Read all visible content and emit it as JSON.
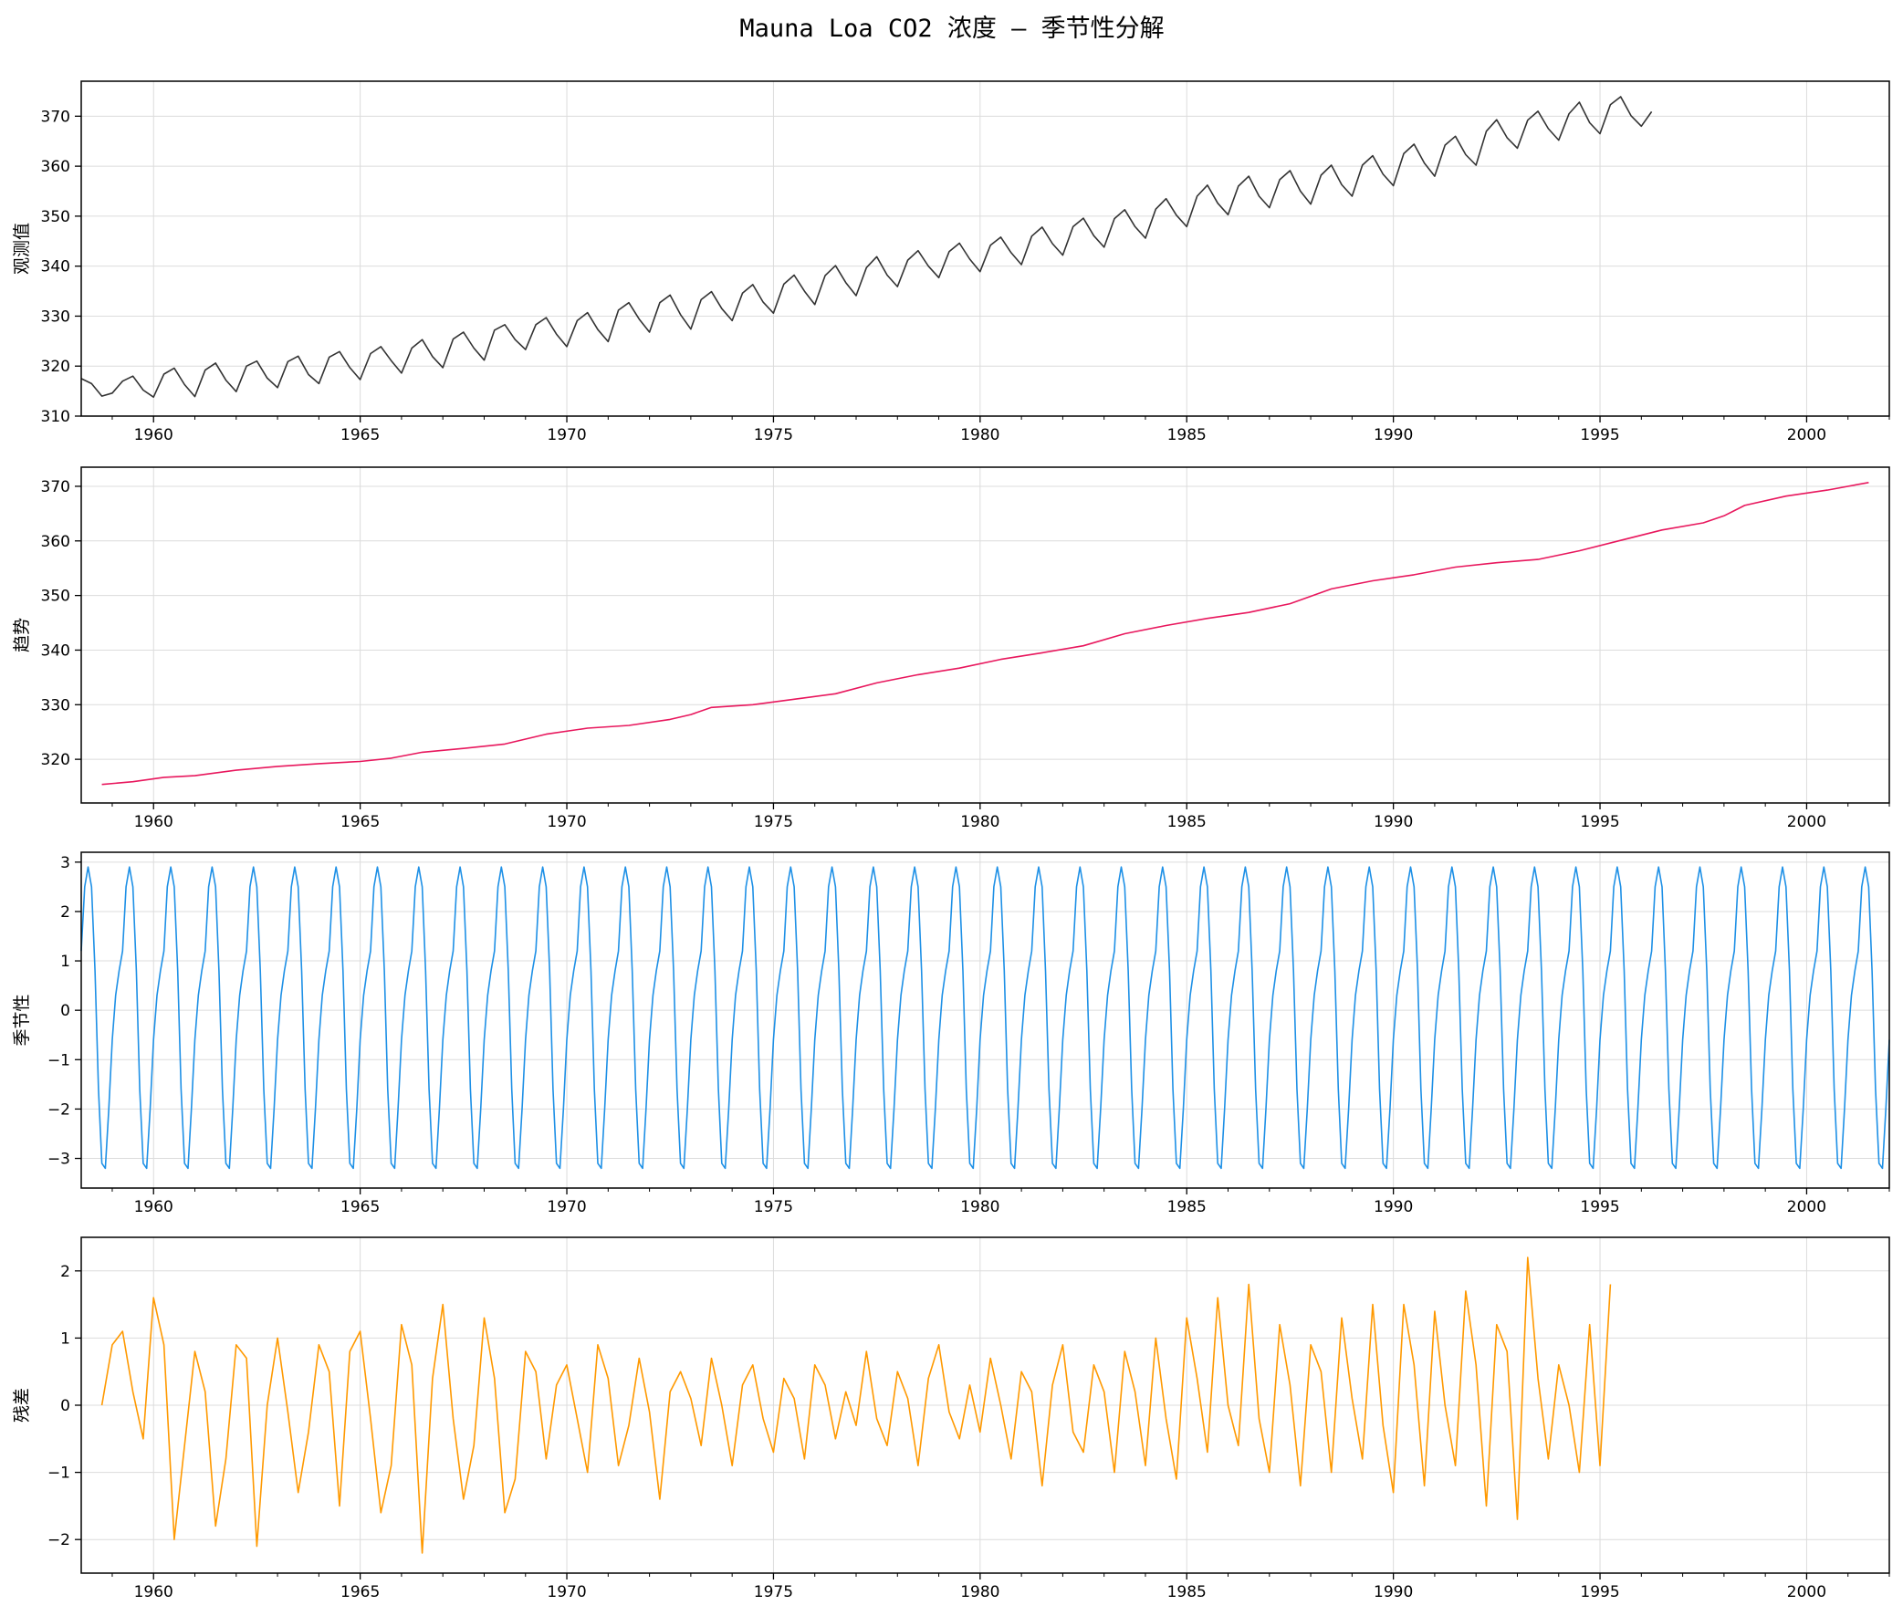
{
  "title": "Mauna Loa CO2 浓度 — 季节性分解",
  "chart_data": [
    {
      "type": "line",
      "ylabel": "观测值",
      "color": "#333333",
      "xlim": [
        1958.25,
        2002.0
      ],
      "ylim": [
        310,
        377
      ],
      "xticks": [
        1960,
        1965,
        1970,
        1975,
        1980,
        1985,
        1990,
        1995,
        2000
      ],
      "xtick_labels": [
        "1960",
        "1965",
        "1970",
        "1975",
        "1980",
        "1985",
        "1990",
        "1995",
        "2000"
      ],
      "yticks": [
        310,
        320,
        330,
        340,
        350,
        360,
        370
      ],
      "ytick_labels": [
        "310",
        "320",
        "330",
        "340",
        "350",
        "360",
        "370"
      ],
      "grid": true,
      "series": [
        {
          "x_start": 1958.25,
          "x_step": 0.25,
          "values": [
            317.5,
            316.5,
            314.0,
            314.6,
            317.0,
            318.0,
            315.2,
            313.8,
            318.4,
            319.6,
            316.3,
            313.9,
            319.2,
            320.6,
            317.2,
            314.9,
            320.0,
            321.0,
            317.6,
            315.7,
            320.9,
            322.0,
            318.3,
            316.5,
            321.8,
            322.9,
            319.7,
            317.3,
            322.5,
            323.9,
            321.1,
            318.6,
            323.6,
            325.3,
            321.9,
            319.7,
            325.4,
            326.8,
            323.6,
            321.2,
            327.2,
            328.3,
            325.3,
            323.3,
            328.3,
            329.7,
            326.4,
            323.9,
            329.1,
            330.7,
            327.3,
            324.9,
            331.2,
            332.7,
            329.4,
            326.8,
            332.7,
            334.2,
            330.3,
            327.4,
            333.3,
            334.9,
            331.5,
            329.1,
            334.6,
            336.3,
            332.8,
            330.6,
            336.4,
            338.2,
            335.0,
            332.3,
            338.1,
            340.1,
            336.7,
            334.1,
            339.7,
            341.9,
            338.2,
            335.9,
            341.2,
            343.1,
            340.0,
            337.7,
            342.9,
            344.6,
            341.4,
            338.9,
            344.2,
            345.8,
            342.7,
            340.3,
            346.0,
            347.8,
            344.5,
            342.2,
            347.9,
            349.6,
            346.1,
            343.8,
            349.5,
            351.3,
            347.9,
            345.6,
            351.4,
            353.5,
            350.2,
            347.9,
            354.0,
            356.2,
            352.6,
            350.3,
            356.0,
            358.0,
            354.0,
            351.7,
            357.3,
            359.1,
            355.0,
            352.4,
            358.2,
            360.2,
            356.3,
            354.0,
            360.2,
            362.1,
            358.4,
            356.1,
            362.5,
            364.4,
            360.6,
            358.0,
            364.2,
            366.0,
            362.3,
            360.2,
            367.0,
            369.3,
            365.7,
            363.6,
            369.2,
            371.0,
            367.5,
            365.2,
            370.5,
            372.8,
            368.7,
            366.5,
            372.3,
            373.9,
            370.1,
            368.0,
            370.9
          ]
        }
      ]
    },
    {
      "type": "line",
      "ylabel": "趋势",
      "color": "#e8175d",
      "xlim": [
        1958.25,
        2002.0
      ],
      "ylim": [
        312,
        373.5
      ],
      "xticks": [
        1960,
        1965,
        1970,
        1975,
        1980,
        1985,
        1990,
        1995,
        2000
      ],
      "xtick_labels": [
        "1960",
        "1965",
        "1970",
        "1975",
        "1980",
        "1985",
        "1990",
        "1995",
        "2000"
      ],
      "yticks": [
        320,
        330,
        340,
        350,
        360,
        370
      ],
      "ytick_labels": [
        "320",
        "330",
        "340",
        "350",
        "360",
        "370"
      ],
      "grid": true,
      "series": [
        {
          "x": [
            1958.75,
            1959.5,
            1960.25,
            1961.0,
            1962.0,
            1963.0,
            1964.0,
            1965.0,
            1965.75,
            1966.5,
            1967.5,
            1968.5,
            1969.5,
            1970.5,
            1971.5,
            1972.5,
            1973.0,
            1973.5,
            1974.5,
            1975.5,
            1976.5,
            1977.5,
            1978.5,
            1979.5,
            1980.5,
            1981.5,
            1982.5,
            1983.5,
            1984.5,
            1985.5,
            1986.5,
            1987.5,
            1988.5,
            1989.5,
            1990.5,
            1991.5,
            1992.5,
            1993.5,
            1994.5,
            1995.5,
            1996.5,
            1997.5,
            1998.0,
            1998.5,
            1999.5,
            2000.5,
            2001.5
          ],
          "values": [
            315.4,
            315.9,
            316.7,
            317.0,
            318.0,
            318.7,
            319.2,
            319.6,
            320.2,
            321.3,
            322.0,
            322.8,
            324.6,
            325.7,
            326.2,
            327.3,
            328.2,
            329.5,
            330.0,
            331.0,
            332.0,
            334.0,
            335.5,
            336.7,
            338.3,
            339.5,
            340.8,
            343.0,
            344.5,
            345.8,
            346.9,
            348.5,
            351.2,
            352.7,
            353.8,
            355.2,
            356.0,
            356.6,
            358.2,
            360.1,
            362.0,
            363.3,
            364.6,
            366.5,
            368.2,
            369.3,
            370.7
          ]
        }
      ]
    },
    {
      "type": "line",
      "ylabel": "季节性",
      "color": "#1e90e6",
      "xlim": [
        1958.25,
        2002.0
      ],
      "ylim": [
        -3.6,
        3.2
      ],
      "xticks": [
        1960,
        1965,
        1970,
        1975,
        1980,
        1985,
        1990,
        1995,
        2000
      ],
      "xtick_labels": [
        "1960",
        "1965",
        "1970",
        "1975",
        "1980",
        "1985",
        "1990",
        "1995",
        "2000"
      ],
      "yticks": [
        -3,
        -2,
        -1,
        0,
        1,
        2,
        3
      ],
      "ytick_labels": [
        "−3",
        "−2",
        "−1",
        "0",
        "1",
        "2",
        "3"
      ],
      "grid": true,
      "series": [
        {
          "x_start": 1958.25,
          "x_step": 0.0833333,
          "cycle_values": [
            1.2,
            2.5,
            2.9,
            2.5,
            0.8,
            -1.6,
            -3.1,
            -3.2,
            -2.0,
            -0.6,
            0.3,
            0.8
          ]
        }
      ]
    },
    {
      "type": "line",
      "ylabel": "残差",
      "color": "#ff9900",
      "xlim": [
        1958.25,
        2002.0
      ],
      "ylim": [
        -2.5,
        2.5
      ],
      "xticks": [
        1960,
        1965,
        1970,
        1975,
        1980,
        1985,
        1990,
        1995,
        2000
      ],
      "xtick_labels": [
        "1960",
        "1965",
        "1970",
        "1975",
        "1980",
        "1985",
        "1990",
        "1995",
        "2000"
      ],
      "yticks": [
        -2,
        -1,
        0,
        1,
        2
      ],
      "ytick_labels": [
        "−2",
        "−1",
        "0",
        "1",
        "2"
      ],
      "grid": true,
      "series": [
        {
          "x_start": 1958.75,
          "x_step": 0.25,
          "values": [
            0.0,
            0.9,
            1.1,
            0.2,
            -0.5,
            1.6,
            0.9,
            -2.0,
            -0.6,
            0.8,
            0.2,
            -1.8,
            -0.8,
            0.9,
            0.7,
            -2.1,
            0.0,
            1.0,
            -0.1,
            -1.3,
            -0.4,
            0.9,
            0.5,
            -1.5,
            0.8,
            1.1,
            -0.2,
            -1.6,
            -0.9,
            1.2,
            0.6,
            -2.2,
            0.4,
            1.5,
            -0.2,
            -1.4,
            -0.6,
            1.3,
            0.4,
            -1.6,
            -1.1,
            0.8,
            0.5,
            -0.8,
            0.3,
            0.6,
            -0.2,
            -1.0,
            0.9,
            0.4,
            -0.9,
            -0.3,
            0.7,
            -0.1,
            -1.4,
            0.2,
            0.5,
            0.1,
            -0.6,
            0.7,
            0.0,
            -0.9,
            0.3,
            0.6,
            -0.2,
            -0.7,
            0.4,
            0.1,
            -0.8,
            0.6,
            0.3,
            -0.5,
            0.2,
            -0.3,
            0.8,
            -0.2,
            -0.6,
            0.5,
            0.1,
            -0.9,
            0.4,
            0.9,
            -0.1,
            -0.5,
            0.3,
            -0.4,
            0.7,
            0.0,
            -0.8,
            0.5,
            0.2,
            -1.2,
            0.3,
            0.9,
            -0.4,
            -0.7,
            0.6,
            0.2,
            -1.0,
            0.8,
            0.2,
            -0.9,
            1.0,
            -0.2,
            -1.1,
            1.3,
            0.4,
            -0.7,
            1.6,
            0.0,
            -0.6,
            1.8,
            -0.2,
            -1.0,
            1.2,
            0.3,
            -1.2,
            0.9,
            0.5,
            -1.0,
            1.3,
            0.1,
            -0.8,
            1.5,
            -0.3,
            -1.3,
            1.5,
            0.6,
            -1.2,
            1.4,
            0.0,
            -0.9,
            1.7,
            0.6,
            -1.5,
            1.2,
            0.8,
            -1.7,
            2.2,
            0.4,
            -0.8,
            0.6,
            0.0,
            -1.0,
            1.2,
            -0.9,
            1.8
          ]
        }
      ]
    }
  ]
}
